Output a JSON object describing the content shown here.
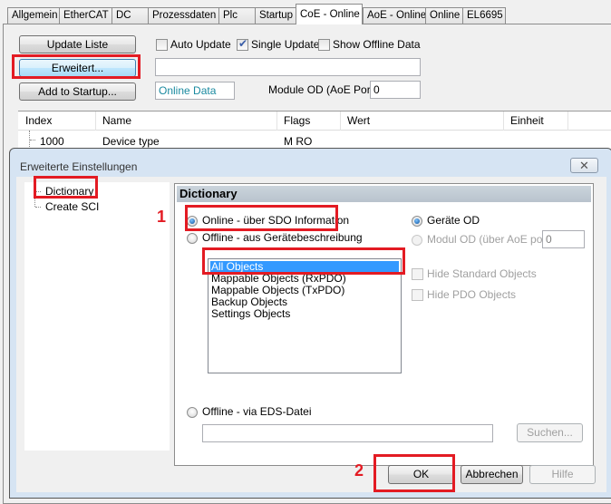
{
  "tabs": [
    {
      "label": "Allgemein",
      "active": false
    },
    {
      "label": "EtherCAT",
      "active": false
    },
    {
      "label": "DC",
      "active": false
    },
    {
      "label": "Prozessdaten",
      "active": false
    },
    {
      "label": "Plc",
      "active": false
    },
    {
      "label": "Startup",
      "active": false
    },
    {
      "label": "CoE - Online",
      "active": true
    },
    {
      "label": "AoE - Online",
      "active": false
    },
    {
      "label": "Online",
      "active": false
    },
    {
      "label": "EL6695",
      "active": false
    }
  ],
  "coe": {
    "update_list_label": "Update Liste",
    "advanced_label": "Erweitert...",
    "add_to_startup_label": "Add to Startup...",
    "auto_update_label": "Auto Update",
    "auto_update_checked": false,
    "single_update_label": "Single Update",
    "single_update_checked": true,
    "show_offline_label": "Show Offline Data",
    "show_offline_checked": false,
    "filter_value": "",
    "online_data_value": "Online Data",
    "module_od_label": "Module OD (AoE Port):",
    "module_od_value": "0"
  },
  "table": {
    "columns": [
      "Index",
      "Name",
      "Flags",
      "Wert",
      "Einheit"
    ],
    "rows": [
      {
        "index": "1000",
        "name": "Device type",
        "flags": "M RO",
        "wert": "",
        "einheit": ""
      }
    ]
  },
  "dialog": {
    "title": "Erweiterte Einstellungen",
    "close_icon": "close-icon",
    "tree": [
      {
        "label": "Dictionary",
        "selected": true
      },
      {
        "label": "Create SCI",
        "selected": false
      }
    ],
    "section_title": "Dictionary",
    "radio_online_label": "Online - über SDO Information",
    "radio_online_checked": true,
    "radio_offline_desc_label": "Offline - aus Gerätebeschreibung",
    "radio_offline_desc_checked": false,
    "object_list": [
      {
        "label": "All Objects",
        "selected": true
      },
      {
        "label": "Mappable Objects (RxPDO)",
        "selected": false
      },
      {
        "label": "Mappable Objects (TxPDO)",
        "selected": false
      },
      {
        "label": "Backup Objects",
        "selected": false
      },
      {
        "label": "Settings Objects",
        "selected": false
      }
    ],
    "radio_geraete_od_label": "Geräte OD",
    "radio_geraete_od_checked": true,
    "radio_modul_od_label": "Modul OD (über AoE port)",
    "modul_od_value": "0",
    "hide_standard_label": "Hide Standard Objects",
    "hide_pdo_label": "Hide PDO Objects",
    "radio_eds_label": "Offline - via EDS-Datei",
    "eds_path_value": "",
    "search_label": "Suchen...",
    "ok_label": "OK",
    "cancel_label": "Abbrechen",
    "help_label": "Hilfe"
  },
  "annotations": {
    "step1": "1",
    "step2": "2",
    "highlight_color": "#e31b23"
  }
}
